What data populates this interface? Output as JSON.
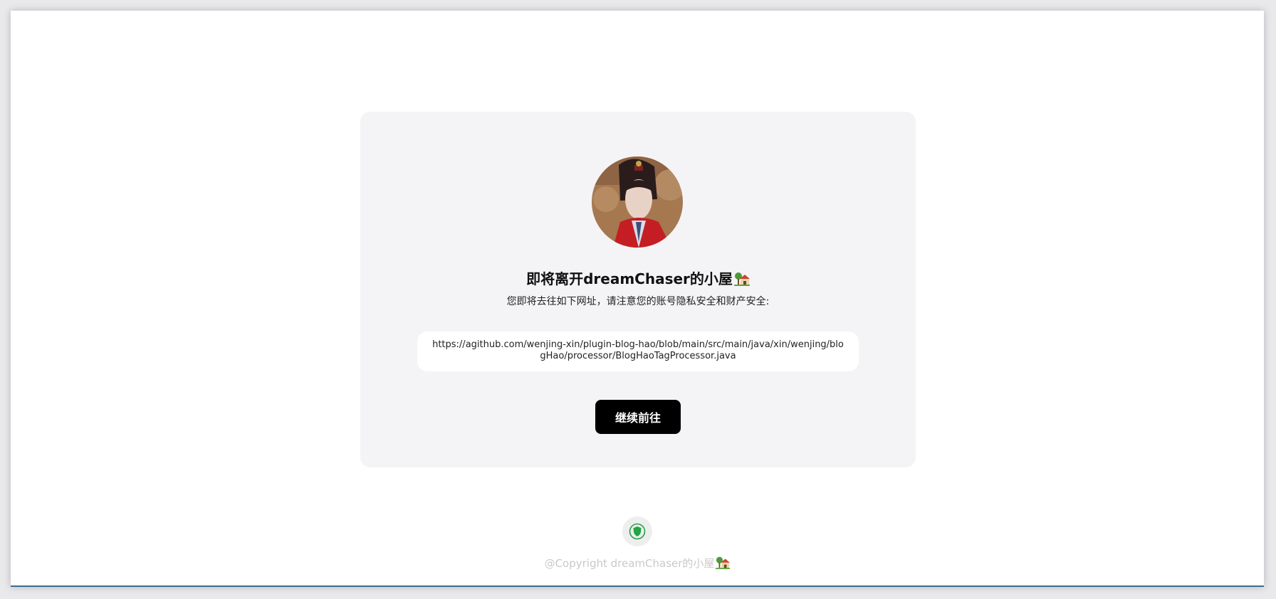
{
  "page": {
    "title": "即将离开dreamChaser的小屋",
    "title_emoji": "house-with-garden-icon",
    "subtitle": "您即将去往如下网址，请注意您的账号隐私安全和财产安全:",
    "target_url": "https://agithub.com/wenjing-xin/plugin-blog-hao/blob/main/src/main/java/xin/wenjing/blogHao/processor/BlogHaoTagProcessor.java",
    "continue_label": "继续前往"
  },
  "footer": {
    "icon": "shield-icon",
    "copyright": "@Copyright dreamChaser的小屋"
  },
  "colors": {
    "card_bg": "#f4f4f6",
    "button_bg": "#000000",
    "shield_green": "#22a447",
    "copyright_text": "#c9c9cc"
  }
}
